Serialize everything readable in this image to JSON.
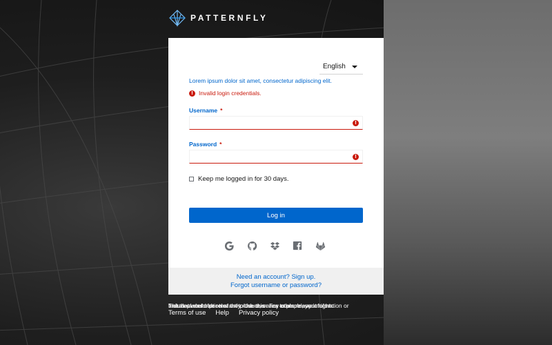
{
  "brand": {
    "name": "PATTERNFLY"
  },
  "login": {
    "language": "English",
    "subtitle": "Lorem ipsum dolor sit amet, consectetur adipiscing elit.",
    "error": "Invalid login credentials.",
    "username_label": "Username",
    "password_label": "Password",
    "required_mark": "*",
    "error_icon": "!",
    "remember_label": "Keep me logged in for 30 days.",
    "login_button": "Log in",
    "socials": [
      "google-icon",
      "github-icon",
      "dropbox-icon",
      "facebook-icon",
      "gitlab-icon"
    ]
  },
  "footer": {
    "signup": "Need an account? Sign up.",
    "forgot": "Forgot username or password?",
    "legal_lines": [
      "This is placeholder text only. Use this area to place any information or",
      "text that would be relevant to the user. For example, you might",
      "include a description of the product, or any other relevant info to"
    ],
    "links": [
      "Terms of use",
      "Help",
      "Privacy policy"
    ]
  },
  "colors": {
    "accent": "#0066cc",
    "danger": "#c9190b"
  }
}
